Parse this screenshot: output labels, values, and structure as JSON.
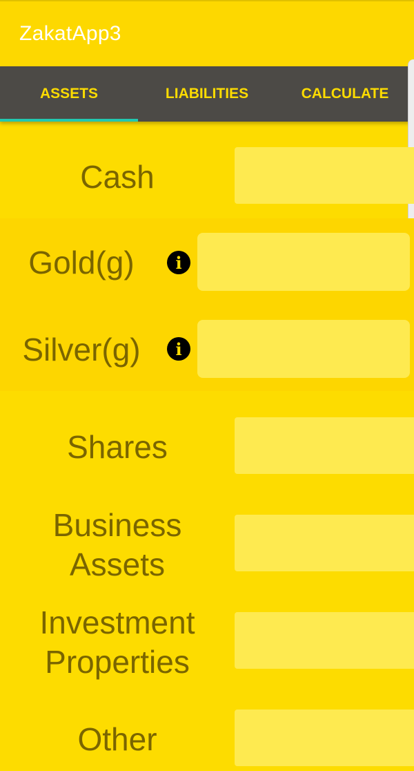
{
  "app": {
    "title": "ZakatApp3"
  },
  "tabs": [
    {
      "label": "ASSETS",
      "selected": true
    },
    {
      "label": "LIABILITIES",
      "selected": false
    },
    {
      "label": "CALCULATE",
      "selected": false
    }
  ],
  "assets": {
    "cash": {
      "label": "Cash",
      "value": ""
    },
    "gold": {
      "label": "Gold(g)",
      "value": "",
      "info_icon": "info-icon"
    },
    "silver": {
      "label": "Silver(g)",
      "value": "",
      "info_icon": "info-icon"
    },
    "shares": {
      "label": "Shares",
      "value": ""
    },
    "business": {
      "label_line1": "Business",
      "label_line2": "Assets",
      "value": ""
    },
    "investment": {
      "label_line1": "Investment",
      "label_line2": "Properties",
      "value": ""
    },
    "other": {
      "label": "Other",
      "value": ""
    }
  },
  "colors": {
    "background": "#FDDC00",
    "tab_bar": "#4C4A46",
    "tab_text": "#FDDC00",
    "tab_indicator": "#22C8B0",
    "label_text": "#7A6500",
    "input_bg": "#FEEA50",
    "band": "#FDD600"
  }
}
